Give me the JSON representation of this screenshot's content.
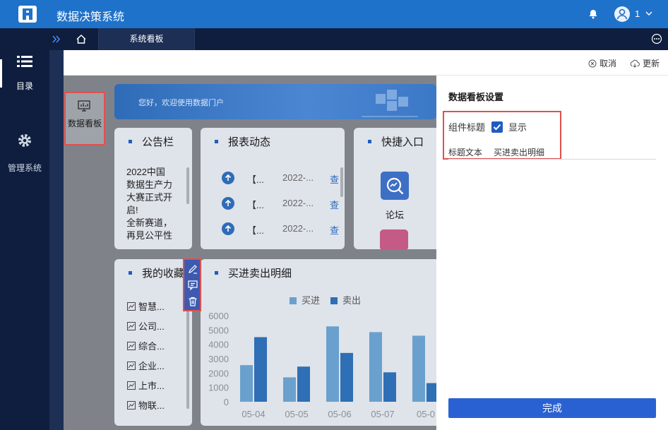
{
  "header": {
    "title": "数据决策系统",
    "user_name": "1"
  },
  "leftnav": {
    "items": [
      {
        "label": "目录"
      },
      {
        "label": "管理系统"
      }
    ]
  },
  "tabbar": {
    "active_tab": "系统看板"
  },
  "actions": {
    "cancel": "取消",
    "refresh": "更新"
  },
  "canvas": {
    "banner_text": "您好，欢迎使用数据门户",
    "component_icon_label": "数据看板",
    "notice": {
      "title": "公告栏",
      "lines": [
        "2022中国",
        "数据生产力",
        "大赛正式开",
        "启!",
        "全新赛道，",
        "再見公平性"
      ]
    },
    "report": {
      "title": "报表动态",
      "rows": [
        {
          "name": "【...",
          "date": "2022-...",
          "link": "查"
        },
        {
          "name": "【...",
          "date": "2022-...",
          "link": "查"
        },
        {
          "name": "【...",
          "date": "2022-...",
          "link": "查"
        }
      ]
    },
    "quick": {
      "title": "快捷入口",
      "item_label": "论坛"
    },
    "favorites": {
      "title": "我的收藏",
      "items": [
        "智慧...",
        "公司...",
        "综合...",
        "企业...",
        "上市...",
        "物联..."
      ]
    },
    "trade": {
      "title": "买进卖出明细"
    }
  },
  "chart_data": {
    "type": "bar",
    "categories": [
      "05-04",
      "05-05",
      "05-06",
      "05-07",
      "05-0"
    ],
    "series": [
      {
        "name": "买进",
        "values": [
          2550,
          1700,
          5250,
          4850,
          4600
        ]
      },
      {
        "name": "卖出",
        "values": [
          4500,
          2450,
          3400,
          2050,
          1300
        ]
      }
    ],
    "ylim": [
      0,
      6000
    ],
    "yticks": [
      "0",
      "1000",
      "2000",
      "3000",
      "4000",
      "5000",
      "6000"
    ],
    "colors": {
      "series0": "#6aa0cd",
      "series1": "#2f6fb5"
    },
    "legend": "top"
  },
  "settings": {
    "title": "数据看板设置",
    "component_title_label": "组件标题",
    "show_label": "显示",
    "title_text_label": "标题文本",
    "title_text_value": "买进卖出明细",
    "done_button": "完成"
  },
  "colors": {
    "brand": "#1f72c9",
    "nav_bg": "#0f1e3e",
    "highlight": "#e05050",
    "primary": "#2a61d2"
  }
}
